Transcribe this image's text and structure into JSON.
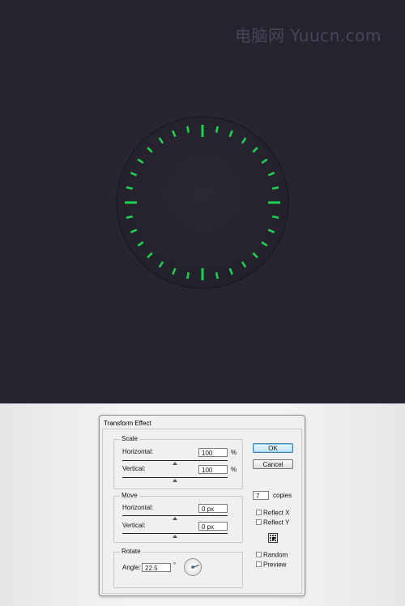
{
  "watermark": "电脑网 Yuucn.com",
  "dial": {
    "tick_color": "#1fd14e",
    "face_color": "#2a2733",
    "background_color": "#26222f",
    "tick_count": 16,
    "ticks_per_major": 4
  },
  "dialog": {
    "title": "Transform Effect",
    "scale": {
      "label": "Scale",
      "horizontal_label": "Horizontal:",
      "horizontal_value": "100",
      "horizontal_unit": "%",
      "vertical_label": "Vertical:",
      "vertical_value": "100",
      "vertical_unit": "%"
    },
    "move": {
      "label": "Move",
      "horizontal_label": "Horizontal:",
      "horizontal_value": "0 px",
      "vertical_label": "Vertical:",
      "vertical_value": "0 px"
    },
    "rotate": {
      "label": "Rotate",
      "angle_label": "Angle:",
      "angle_value": "22.5",
      "angle_unit": "°"
    },
    "ok_label": "OK",
    "cancel_label": "Cancel",
    "copies_value": "7",
    "copies_label": "copies",
    "reflect_x_label": "Reflect X",
    "reflect_y_label": "Reflect Y",
    "random_label": "Random",
    "preview_label": "Preview"
  }
}
